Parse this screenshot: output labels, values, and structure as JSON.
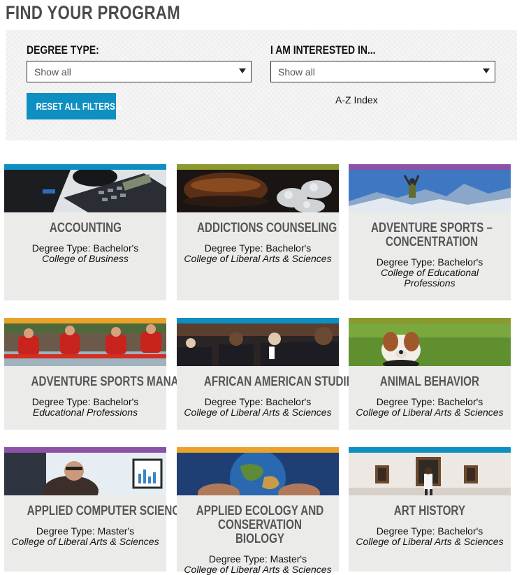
{
  "header": {
    "title": "FIND YOUR PROGRAM"
  },
  "filters": {
    "degree_type": {
      "label": "DEGREE TYPE:",
      "value": "Show all"
    },
    "interest": {
      "label": "I AM INTERESTED IN...",
      "value": "Show all"
    },
    "reset_label": "RESET ALL FILTERS »",
    "az_index_label": "A-Z Index"
  },
  "colors": {
    "blue": "#0e8fc1",
    "green": "#8a9a2e",
    "purple": "#8a53a6",
    "orange": "#e9a32a"
  },
  "programs": [
    {
      "title": "ACCOUNTING",
      "degree_type": "Degree Type: Bachelor's",
      "college": "College of Business",
      "accent": "#0e8fc1",
      "image": "calculator-keyboard-photo"
    },
    {
      "title": "ADDICTIONS COUNSELING",
      "degree_type": "Degree Type: Bachelor's",
      "college": "College of Liberal Arts & Sciences",
      "accent": "#8a9a2e",
      "image": "glass-and-pills-photo"
    },
    {
      "title": "ADVENTURE SPORTS – CONCENTRATION",
      "degree_type": "Degree Type: Bachelor's",
      "college": "College of Educational Professions",
      "accent": "#8a53a6",
      "image": "mountain-summit-photo"
    },
    {
      "title": "ADVENTURE SPORTS MANAGEMENT",
      "degree_type": "Degree Type: Bachelor's",
      "college": "Educational Professions",
      "accent": "#e9a32a",
      "image": "river-rafting-photo"
    },
    {
      "title": "AFRICAN AMERICAN STUDIES MINOR",
      "degree_type": "Degree Type: Bachelor's",
      "college": "College of Liberal Arts & Sciences",
      "accent": "#0e8fc1",
      "image": "crowd-handshake-photo"
    },
    {
      "title": "ANIMAL BEHAVIOR",
      "degree_type": "Degree Type: Bachelor's",
      "college": "College of Liberal Arts & Sciences",
      "accent": "#8a9a2e",
      "image": "dog-in-grass-photo"
    },
    {
      "title": "APPLIED COMPUTER SCIENCE",
      "degree_type": "Degree Type: Master's",
      "college": "College of Liberal Arts & Sciences",
      "accent": "#8a53a6",
      "image": "man-at-computer-photo"
    },
    {
      "title": "APPLIED ECOLOGY AND CONSERVATION BIOLOGY",
      "degree_type": "Degree Type: Master's",
      "college": "College of Liberal Arts & Sciences",
      "accent": "#e9a32a",
      "image": "hands-holding-earth-photo"
    },
    {
      "title": "ART HISTORY",
      "degree_type": "Degree Type: Bachelor's",
      "college": "College of Liberal Arts & Sciences",
      "accent": "#0e8fc1",
      "image": "art-gallery-photo"
    }
  ]
}
